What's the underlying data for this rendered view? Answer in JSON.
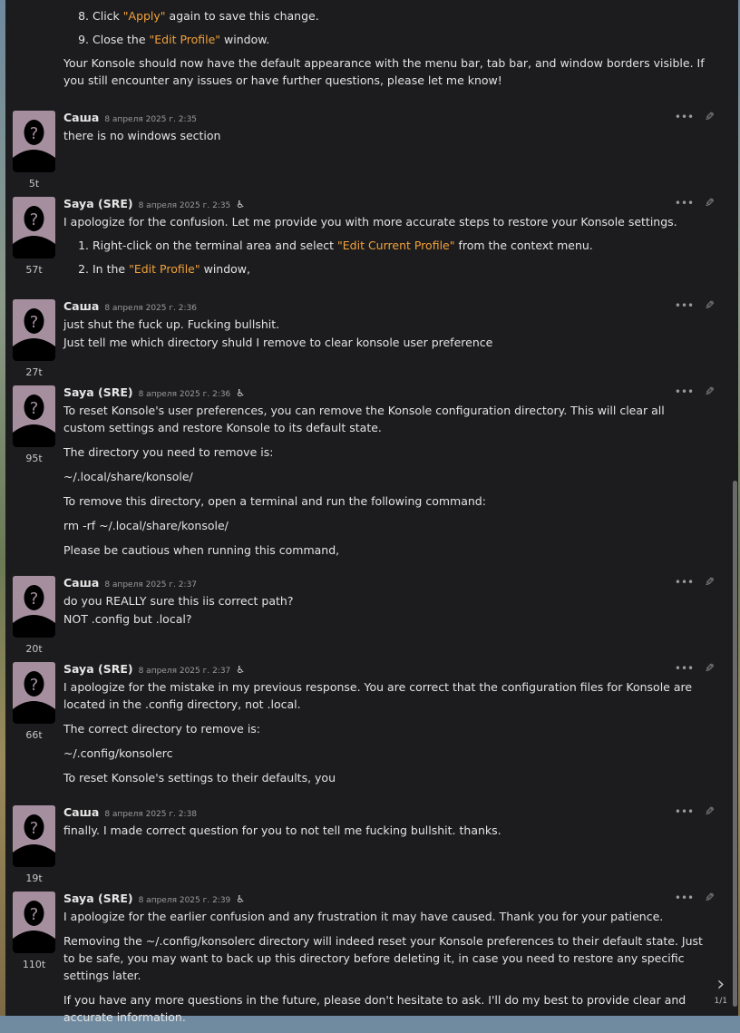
{
  "messages": [
    {
      "author": "Саша",
      "time": "8 апреля 2025 г. 2:35",
      "tokens": "5t",
      "lines": [
        "there is no windows section"
      ]
    },
    {
      "author": "Saya (SRE)",
      "time": "8 апреля 2025 г. 2:35",
      "tokens": "57t",
      "intro": "I apologize for the confusion. Let me provide you with more accurate steps to restore your Konsole settings.",
      "step1_pre": "Right-click on the terminal area and select ",
      "step1_hl": "\"Edit Current Profile\"",
      "step1_post": " from the context menu.",
      "step2_pre": "In the ",
      "step2_hl": "\"Edit Profile\"",
      "step2_post": " window,"
    },
    {
      "author": "Саша",
      "time": "8 апреля 2025 г. 2:36",
      "tokens": "27t",
      "lines": [
        "just shut the fuck up. Fucking bullshit.",
        "Just tell me which directory shuld I remove to clear konsole user preference"
      ]
    },
    {
      "author": "Saya (SRE)",
      "time": "8 апреля 2025 г. 2:36",
      "tokens": "95t",
      "paragraphs": [
        "To reset Konsole's user preferences, you can remove the Konsole configuration directory. This will clear all custom settings and restore Konsole to its default state.",
        "The directory you need to remove is:",
        "~/.local/share/konsole/",
        "To remove this directory, open a terminal and run the following command:",
        "rm -rf ~/.local/share/konsole/",
        "Please be cautious when running this command,"
      ]
    },
    {
      "author": "Саша",
      "time": "8 апреля 2025 г. 2:37",
      "tokens": "20t",
      "lines": [
        "do you REALLY sure this iis correct path?",
        "NOT .config but .local?"
      ]
    },
    {
      "author": "Saya (SRE)",
      "time": "8 апреля 2025 г. 2:37",
      "tokens": "66t",
      "paragraphs": [
        "I apologize for the mistake in my previous response. You are correct that the configuration files for Konsole are located in the .config directory, not .local.",
        "The correct directory to remove is:",
        "~/.config/konsolerc",
        "To reset Konsole's settings to their defaults, you"
      ]
    },
    {
      "author": "Саша",
      "time": "8 апреля 2025 г. 2:38",
      "tokens": "19t",
      "lines": [
        "finally. I made correct question for you to not tell me fucking bullshit. thanks."
      ]
    },
    {
      "author": "Saya (SRE)",
      "time": "8 апреля 2025 г. 2:39",
      "tokens": "110t",
      "paragraphs": [
        "I apologize for the earlier confusion and any frustration it may have caused. Thank you for your patience.",
        "Removing the ~/.config/konsolerc directory will indeed reset your Konsole preferences to their default state. Just to be safe, you may want to back up this directory before deleting it, in case you need to restore any specific settings later.",
        "If you have any more questions in the future, please don't hesitate to ask. I'll do my best to provide clear and accurate information."
      ]
    }
  ],
  "top_message": {
    "step8_pre": "Click ",
    "step8_hl": "\"Apply\"",
    "step8_post": " again to save this change.",
    "step9_pre": "Close the ",
    "step9_hl": "\"Edit Profile\"",
    "step9_post": " window.",
    "closing": "Your Konsole should now have the default appearance with the menu bar, tab bar, and window borders visible. If you still encounter any issues or have further questions, please let me know!"
  },
  "icons": {
    "bot": "bot-assistant-icon",
    "more": "more-options-icon",
    "edit": "edit-pencil-icon",
    "next": "chevron-right-icon"
  },
  "pager": {
    "label": "1/1"
  },
  "colors": {
    "highlight": "#f2a13a",
    "panel": "#1c1c1e",
    "avatar": "#a58f9f"
  }
}
